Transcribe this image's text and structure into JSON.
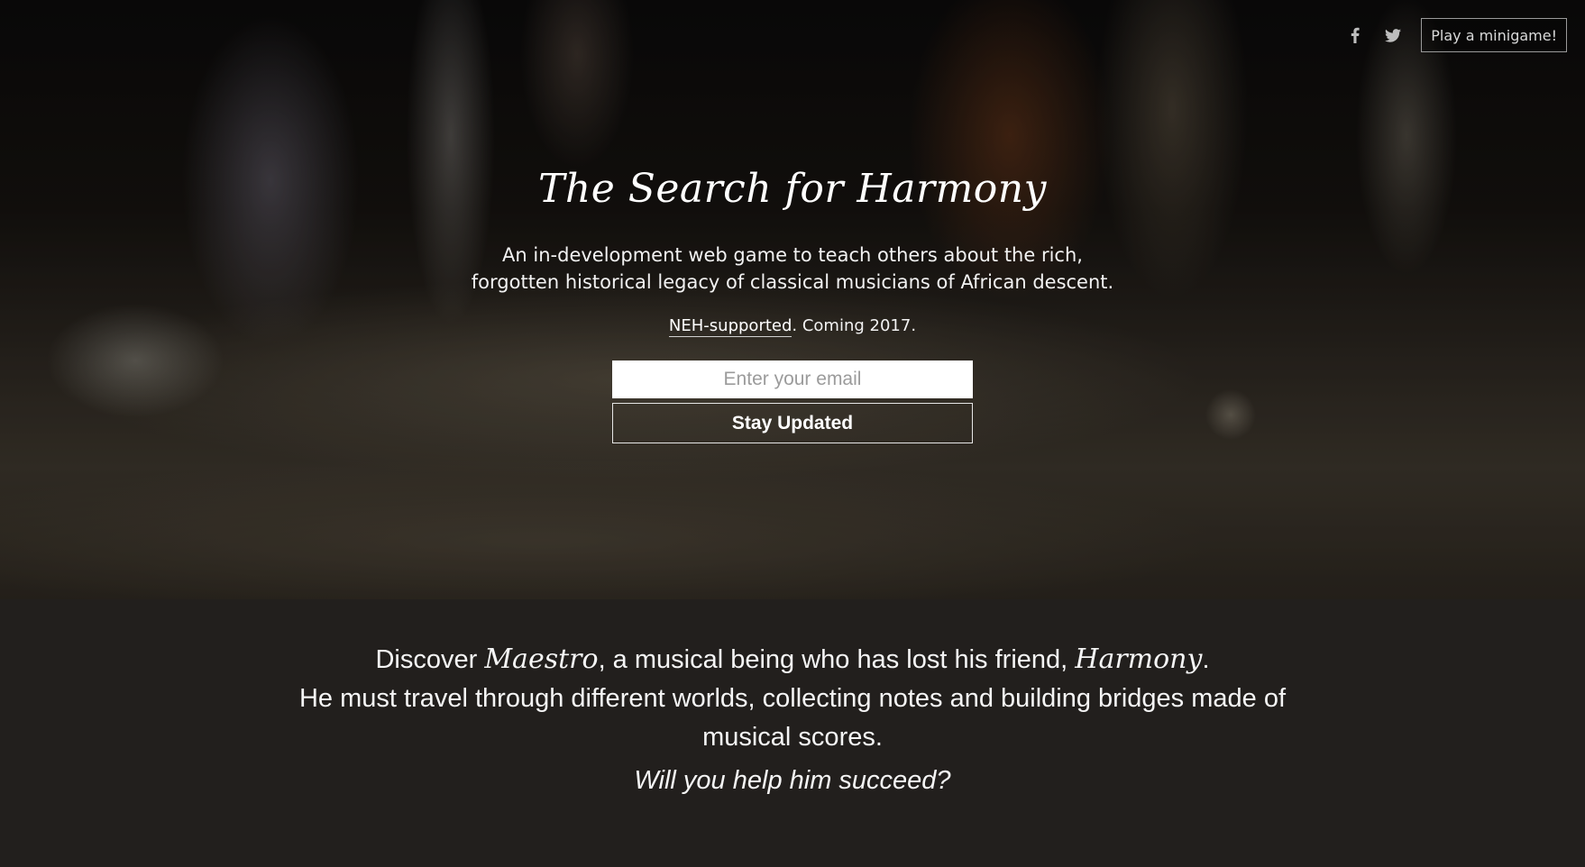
{
  "topbar": {
    "facebook_icon": "facebook-icon",
    "twitter_icon": "twitter-icon",
    "minigame_label": "Play a minigame!"
  },
  "hero": {
    "title": "The Search for Harmony",
    "subtitle_line1": "An in-development web game to teach others about the rich,",
    "subtitle_line2": "forgotten historical legacy of classical musicians of African descent.",
    "support_link": "NEH-supported",
    "support_rest": ". Coming 2017."
  },
  "signup": {
    "email_placeholder": "Enter your email",
    "email_value": "",
    "button_label": "Stay Updated"
  },
  "story": {
    "part1": "Discover ",
    "maestro": "Maestro",
    "part2": ", a musical being who has lost his friend, ",
    "harmony": "Harmony",
    "part3": ".",
    "line2": "He must travel through different worlds, collecting notes and building bridges made of musical scores.",
    "question": "Will you help him succeed?"
  },
  "colors": {
    "story_bg": "#221f1d",
    "text": "#ffffff",
    "button_border": "#e6e6e6"
  }
}
